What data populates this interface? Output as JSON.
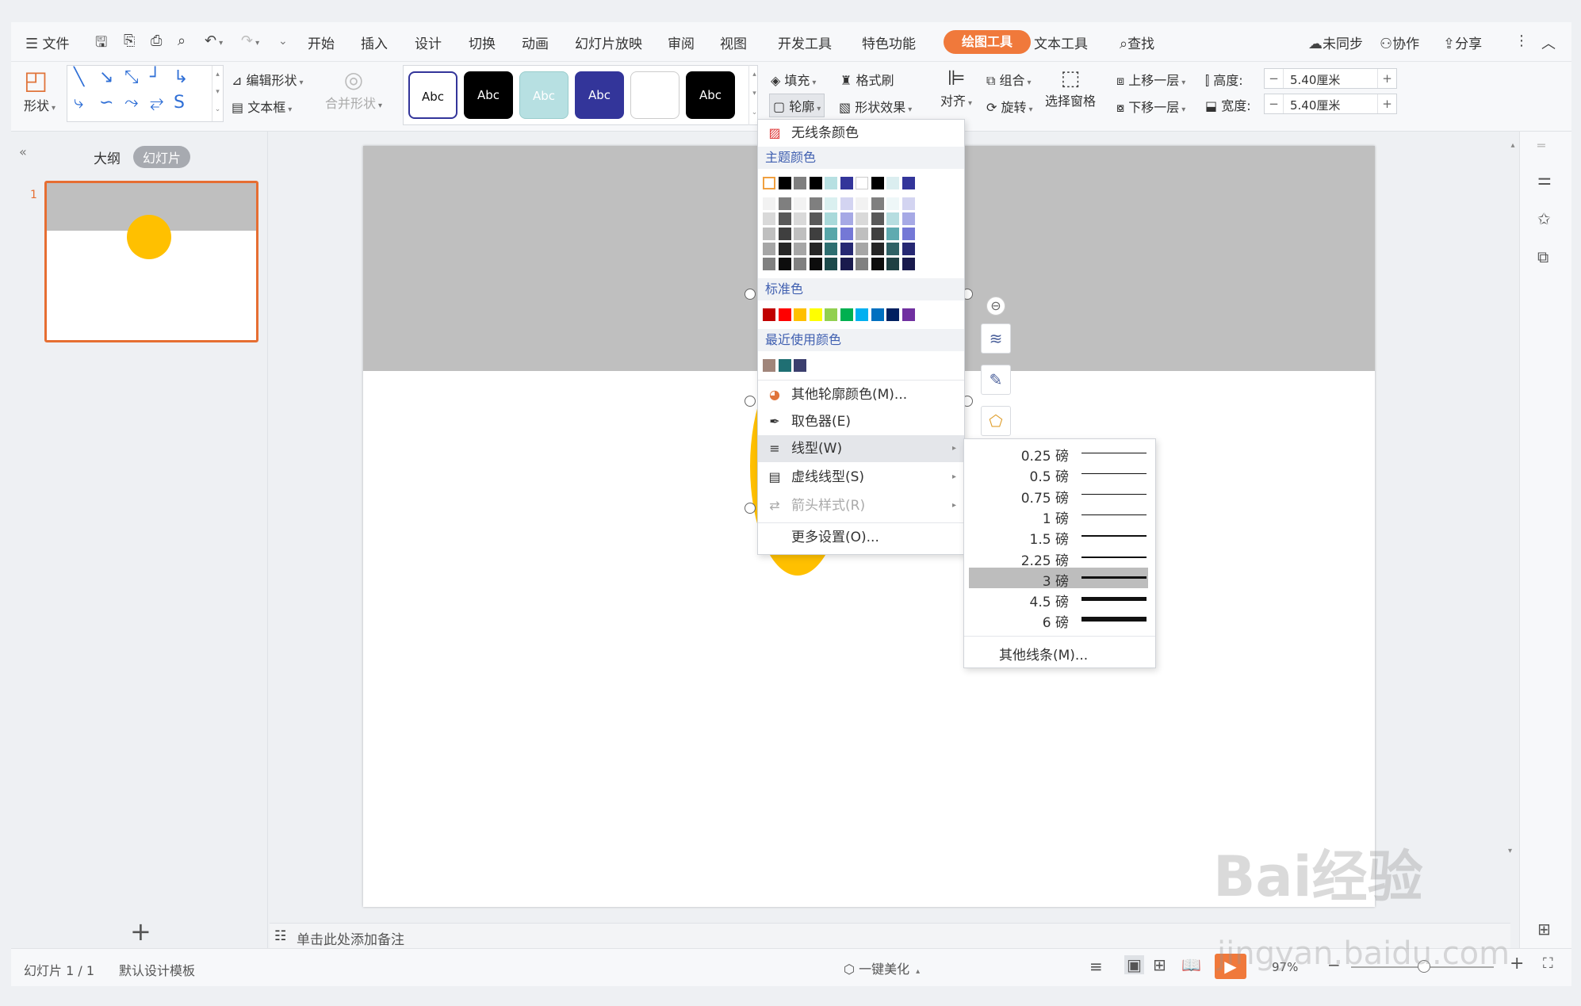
{
  "menubar": {
    "file": "文件",
    "tabs": [
      "开始",
      "插入",
      "设计",
      "切换",
      "动画",
      "幻灯片放映",
      "审阅",
      "视图",
      "开发工具",
      "特色功能",
      "绘图工具",
      "文本工具"
    ],
    "search": "查找",
    "sync": "未同步",
    "collab": "协作",
    "share": "分享"
  },
  "ribbon": {
    "shape": "形状",
    "edit_shape": "编辑形状",
    "textbox": "文本框",
    "merge_shape": "合并形状",
    "style_label": "Abc",
    "fill": "填充",
    "format_brush": "格式刷",
    "outline": "轮廓",
    "shape_effect": "形状效果",
    "align": "对齐",
    "group": "组合",
    "rotate": "旋转",
    "selection_pane": "选择窗格",
    "bring_forward": "上移一层",
    "send_backward": "下移一层",
    "height_label": "高度:",
    "width_label": "宽度:",
    "height_value": "5.40厘米",
    "width_value": "5.40厘米"
  },
  "left_panel": {
    "outline_tab": "大纲",
    "slides_tab": "幻灯片",
    "slide_number": "1"
  },
  "outline_menu": {
    "no_line_color": "无线条颜色",
    "theme_colors": "主题颜色",
    "theme_top_row": [
      "#ffffff",
      "#000000",
      "#7f7f7f",
      "#000000",
      "#b7e0e2",
      "#33359a",
      "#ffffff",
      "#000000",
      "#dbeef0",
      "#33359a"
    ],
    "theme_grid": [
      [
        "#f2f2f2",
        "#7f7f7f",
        "#f2f2f2",
        "#7f7f7f",
        "#daf0f0",
        "#d3d4f1",
        "#f2f2f2",
        "#7f7f7f",
        "#eef7f8",
        "#d3d4f1"
      ],
      [
        "#d9d9d9",
        "#595959",
        "#d9d9d9",
        "#595959",
        "#a9d9da",
        "#a6a9e5",
        "#d9d9d9",
        "#595959",
        "#b6dde0",
        "#a6a9e5"
      ],
      [
        "#bfbfbf",
        "#3f3f3f",
        "#bfbfbf",
        "#3f3f3f",
        "#58a6a9",
        "#7478d6",
        "#bfbfbf",
        "#3f3f3f",
        "#5faab0",
        "#7478d6"
      ],
      [
        "#a6a6a6",
        "#262626",
        "#a6a6a6",
        "#262626",
        "#2d6e70",
        "#262873",
        "#a6a6a6",
        "#262626",
        "#2f6165",
        "#262873"
      ],
      [
        "#808080",
        "#0d0d0d",
        "#808080",
        "#0d0d0d",
        "#1d4a4b",
        "#191a4d",
        "#808080",
        "#0d0d0d",
        "#1f4043",
        "#191a4d"
      ]
    ],
    "standard_colors_label": "标准色",
    "standard_colors": [
      "#c00000",
      "#ff0000",
      "#ffc000",
      "#ffff00",
      "#92d050",
      "#00b050",
      "#00b0f0",
      "#0070c0",
      "#002060",
      "#7030a0"
    ],
    "recent_colors_label": "最近使用颜色",
    "recent_colors": [
      "#a0857a",
      "#1f6f73",
      "#3b3f6e"
    ],
    "other_colors": "其他轮廓颜色(M)...",
    "eyedropper": "取色器(E)",
    "line_type": "线型(W)",
    "dash_type": "虚线线型(S)",
    "arrow_style": "箭头样式(R)",
    "more_settings": "更多设置(O)..."
  },
  "line_weights": {
    "items": [
      {
        "label": "0.25 磅",
        "weight": 0.25
      },
      {
        "label": "0.5 磅",
        "weight": 0.5
      },
      {
        "label": "0.75 磅",
        "weight": 0.75
      },
      {
        "label": "1 磅",
        "weight": 1
      },
      {
        "label": "1.5 磅",
        "weight": 1.5
      },
      {
        "label": "2.25 磅",
        "weight": 2.25
      },
      {
        "label": "3 磅",
        "weight": 3
      },
      {
        "label": "4.5 磅",
        "weight": 4.5
      },
      {
        "label": "6 磅",
        "weight": 6
      }
    ],
    "selected": "3 磅",
    "other_lines": "其他线条(M)..."
  },
  "notes_placeholder": "单击此处添加备注",
  "status": {
    "slide_info": "幻灯片 1 / 1",
    "template": "默认设计模板",
    "beautify": "一键美化",
    "zoom": "97%"
  },
  "watermark": {
    "brand": "Bai经验",
    "url": "jingyan.baidu.com"
  },
  "colors": {
    "accent": "#f0793b",
    "slide_header": "#bfbfbf",
    "circle": "#ffc000"
  }
}
